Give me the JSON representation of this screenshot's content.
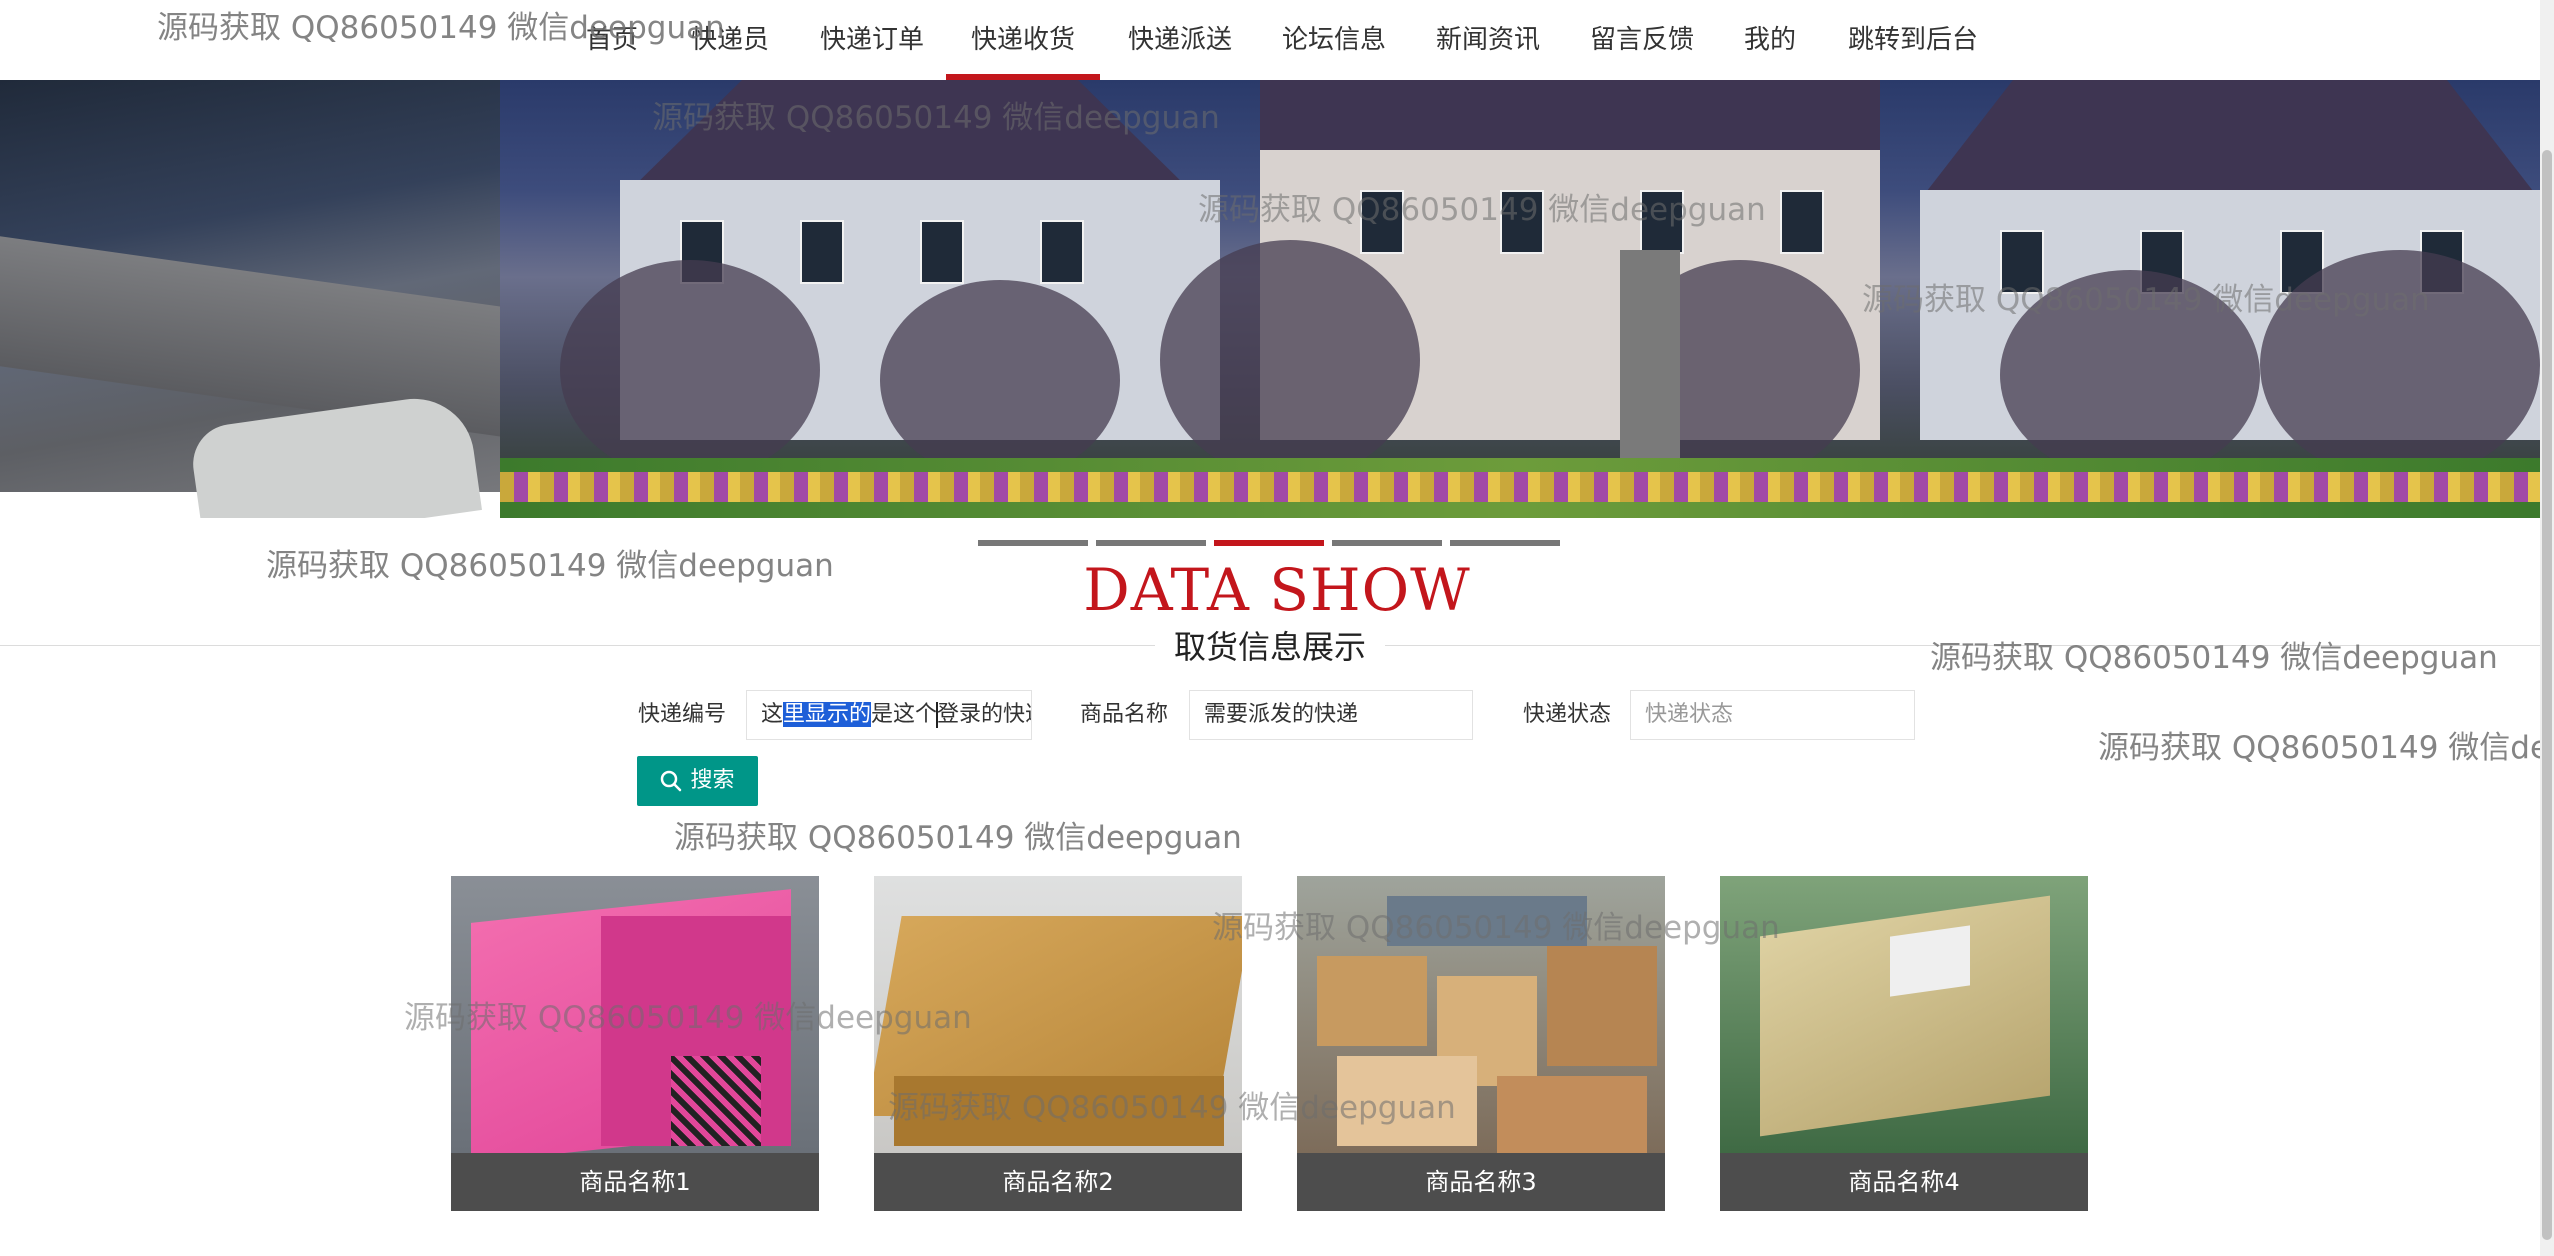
{
  "nav": {
    "items": [
      "首页",
      "快递员",
      "快递订单",
      "快递收货",
      "快递派送",
      "论坛信息",
      "新闻资讯",
      "留言反馈",
      "我的",
      "跳转到后台"
    ],
    "active_index": 3
  },
  "banner": {
    "slide_count": 5,
    "active_slide": 2
  },
  "section": {
    "title_en": "DATA SHOW",
    "title_cn": "取货信息展示"
  },
  "search": {
    "field1_label": "快递编号",
    "field1_value_pre": "这",
    "field1_value_selected": "里显示的",
    "field1_value_mid": "是这个",
    "field1_value_post": "登录的快递",
    "field2_label": "商品名称",
    "field2_value": "需要派发的快递",
    "field3_label": "快递状态",
    "field3_placeholder": "快递状态",
    "button_label": "搜索",
    "button_color": "#009688"
  },
  "products": [
    {
      "name": "商品名称1"
    },
    {
      "name": "商品名称2"
    },
    {
      "name": "商品名称3"
    },
    {
      "name": "商品名称4"
    }
  ],
  "watermark": "源码获取 QQ86050149 微信deepguan",
  "colors": {
    "accent": "#c3161c",
    "button": "#009688",
    "caption_bg": "#4d4d4d"
  }
}
